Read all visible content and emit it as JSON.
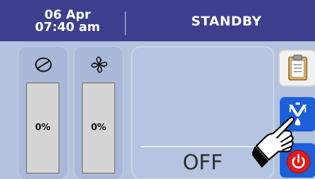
{
  "header": {
    "date": "06 Apr",
    "time": "07:40 am",
    "status": "STANDBY"
  },
  "gauges": [
    {
      "icon": "compressor-icon",
      "label": "0%",
      "level_percent": 0
    },
    {
      "icon": "fan-icon",
      "label": "0%",
      "level_percent": 0
    }
  ],
  "main": {
    "state_label": "OFF"
  },
  "side_buttons": [
    {
      "icon": "clipboard-icon"
    },
    {
      "icon": "defrost-drip-icon"
    },
    {
      "icon": "power-icon"
    }
  ],
  "colors": {
    "topbar": "#3f3f8f",
    "background": "#b3c2dd",
    "button_blue": "#1d5fd7",
    "power_red": "#e01c1c"
  }
}
